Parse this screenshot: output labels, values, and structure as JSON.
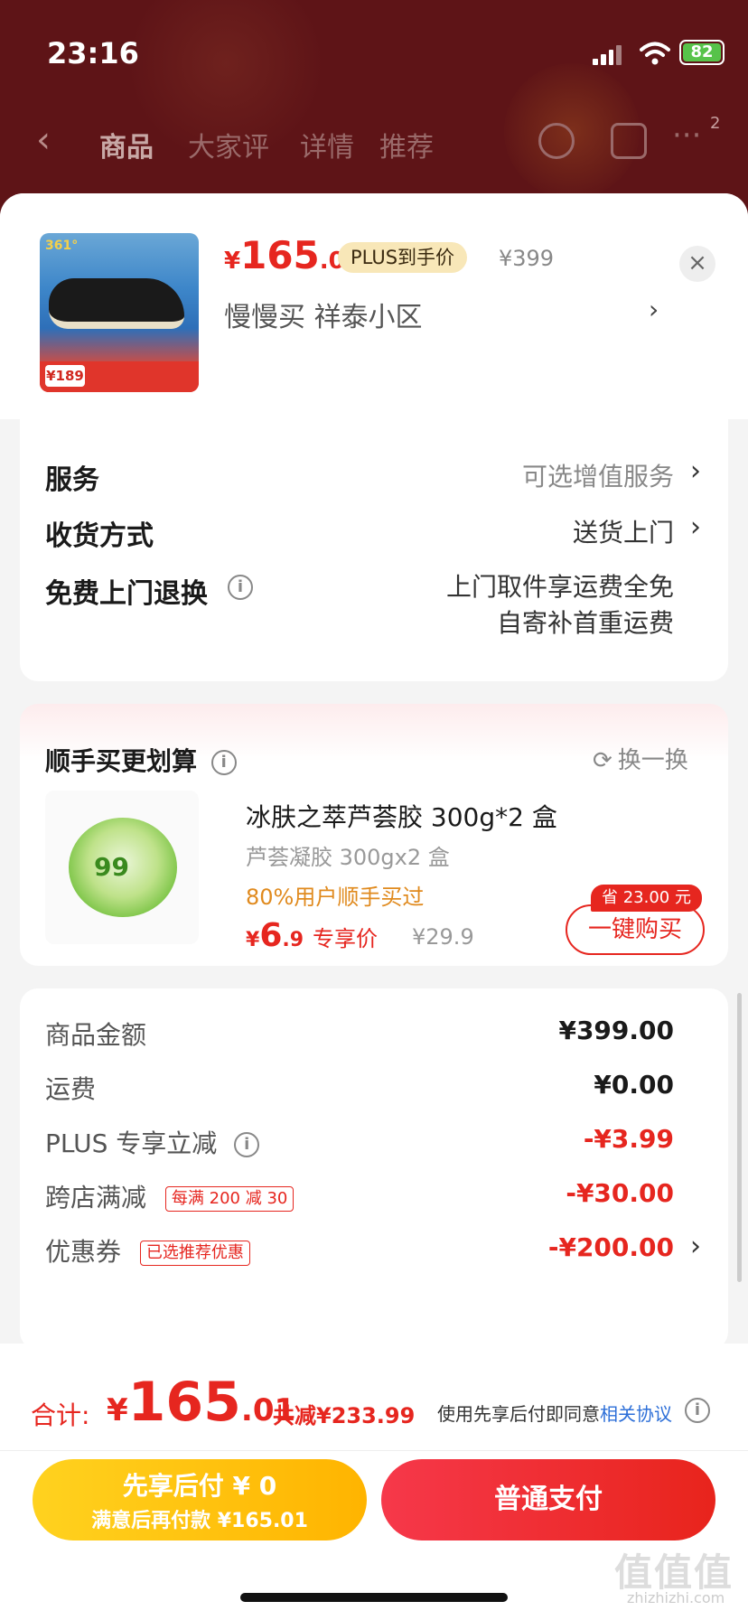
{
  "status": {
    "time": "23:16",
    "battery": "82"
  },
  "background_nav": {
    "tabs": [
      "商品",
      "大家评",
      "详情",
      "推荐"
    ],
    "badge": "2"
  },
  "header": {
    "price_currency": "¥",
    "price_int": "165",
    "price_dec": ".01",
    "plus_tag": "PLUS到手价",
    "original_price": "¥399",
    "address": "慢慢买  祥泰小区",
    "thumb_logo": "361°",
    "thumb_price": "¥189"
  },
  "options": {
    "service_label": "服务",
    "service_value": "可选增值服务",
    "delivery_label": "收货方式",
    "delivery_value": "送货上门",
    "return_label": "免费上门退换",
    "return_line1": "上门取件享运费全免",
    "return_line2": "自寄补首重运费"
  },
  "addon": {
    "title": "顺手买更划算",
    "swap_label": "换一换",
    "product_name": "冰肤之萃芦荟胶 300g*2 盒",
    "spec": "芦荟凝胶 300gx2 盒",
    "buyers": "80%用户顺手买过",
    "price_currency": "¥",
    "price_int": "6",
    "price_dec": ".9",
    "price_tag": "专享价",
    "original_price": "¥29.9",
    "save_tag": "省 23.00 元",
    "buy_button": "一键购买",
    "jar_label": "99"
  },
  "summary": {
    "rows": [
      {
        "label": "商品金额",
        "value": "¥399.00"
      },
      {
        "label": "运费",
        "value": "¥0.00"
      },
      {
        "label": "PLUS 专享立减",
        "value": "-¥3.99"
      },
      {
        "label": "跨店满减",
        "tag": "每满 200 减 30",
        "value": "-¥30.00"
      },
      {
        "label": "优惠券",
        "tag": "已选推荐优惠",
        "value": "-¥200.00"
      }
    ]
  },
  "footer": {
    "total_label": "合计:",
    "total_currency": "¥",
    "total_int": "165",
    "total_dec": ".01",
    "total_saved": "共减¥233.99",
    "agree_text": "使用先享后付即同意",
    "agree_link": "相关协议",
    "pay_later_line1": "先享后付 ¥ 0",
    "pay_later_line2": "满意后再付款 ¥165.01",
    "pay_button": "普通支付"
  },
  "watermark": {
    "main": "值值值",
    "sub": "zhizhizhi.com"
  },
  "colors": {
    "accent_red": "#e6261f",
    "pay_later_yellow": "#ffc107",
    "link_blue": "#2d6fd8"
  }
}
